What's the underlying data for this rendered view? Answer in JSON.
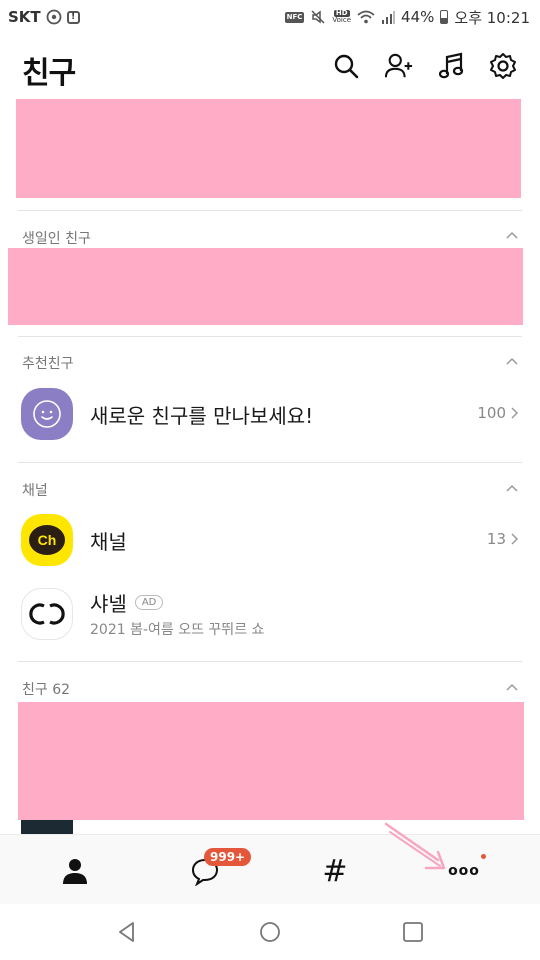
{
  "status_bar": {
    "carrier": "SKT",
    "battery": "44%",
    "time": "오후 10:21",
    "nfc": "NFC",
    "hd": "HD",
    "voice": "Voice"
  },
  "header": {
    "title": "친구",
    "icons": [
      "search-icon",
      "add-friend-icon",
      "music-icon",
      "settings-icon"
    ]
  },
  "sections": {
    "birthday": {
      "label": "생일인 친구"
    },
    "recommended": {
      "label": "추천친구",
      "item": {
        "title": "새로운 친구를 만나보세요!",
        "count": "100"
      }
    },
    "channel": {
      "label": "채널",
      "items": [
        {
          "title": "채널",
          "count": "13",
          "avatar_text": "Ch"
        },
        {
          "title": "샤넬",
          "badge": "AD",
          "subtitle": "2021 봄-여름 오뜨 꾸뛰르 쇼"
        }
      ]
    },
    "friends": {
      "label": "친구 62"
    }
  },
  "tab_bar": {
    "chat_badge": "999+",
    "hashtag": "#",
    "more": "ooo"
  },
  "colors": {
    "redacted": "#ffadc6",
    "kakao_yellow": "#ffe600",
    "badge_red": "#e4573a",
    "purple_avatar": "#8c7ec4"
  }
}
